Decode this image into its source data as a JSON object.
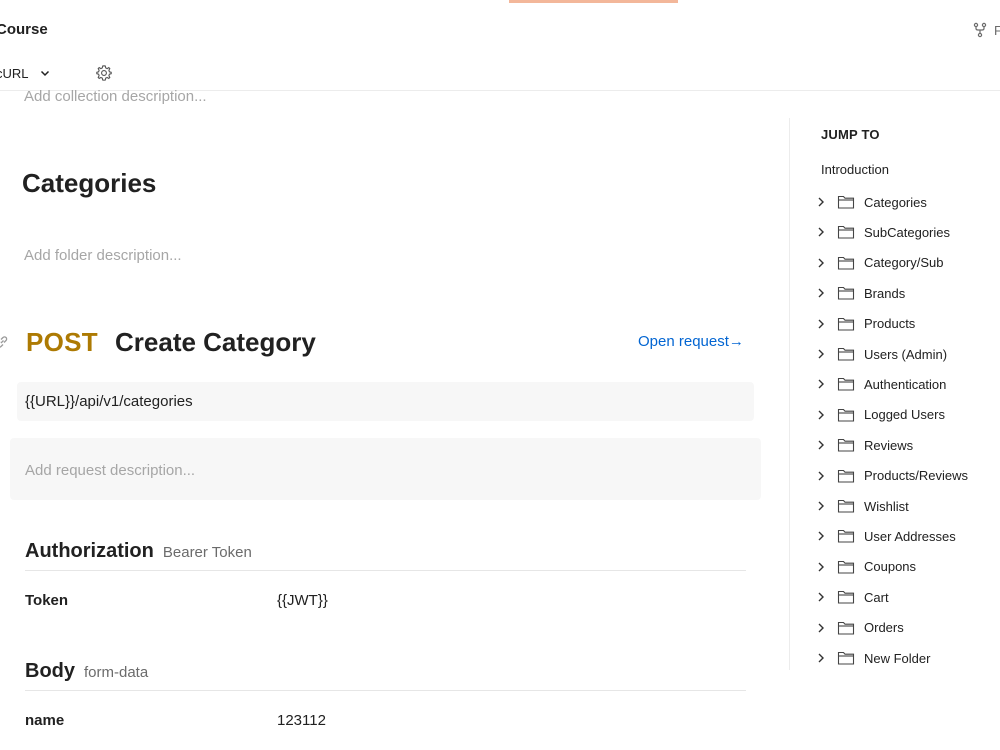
{
  "header": {
    "title": "Course",
    "fork_label": "F",
    "language": "cURL"
  },
  "collection": {
    "description_placeholder": "Add collection description..."
  },
  "folder": {
    "title": "Categories",
    "description_placeholder": "Add folder description..."
  },
  "request": {
    "method": "POST",
    "name": "Create Category",
    "open_request_label": "Open request→",
    "url": "{{URL}}/api/v1/categories",
    "description_placeholder": "Add request description...",
    "method_color": "#ad7a03"
  },
  "authorization": {
    "title": "Authorization",
    "type": "Bearer Token",
    "key": "Token",
    "value": "{{JWT}}"
  },
  "body": {
    "title": "Body",
    "type": "form-data",
    "key": "name",
    "value": "123112"
  },
  "jump_to": {
    "heading": "JUMP TO",
    "intro": "Introduction",
    "items": [
      {
        "label": "Categories"
      },
      {
        "label": "SubCategories"
      },
      {
        "label": "Category/Sub"
      },
      {
        "label": "Brands"
      },
      {
        "label": "Products"
      },
      {
        "label": "Users (Admin)"
      },
      {
        "label": "Authentication"
      },
      {
        "label": "Logged Users"
      },
      {
        "label": "Reviews"
      },
      {
        "label": "Products/Reviews"
      },
      {
        "label": "Wishlist"
      },
      {
        "label": "User Addresses"
      },
      {
        "label": "Coupons"
      },
      {
        "label": "Cart"
      },
      {
        "label": "Orders"
      },
      {
        "label": "New Folder"
      }
    ]
  },
  "icons": {
    "fork": "fork-icon",
    "chevron_down": "chevron-down-icon",
    "gear": "gear-icon",
    "link": "link-icon",
    "chevron_right": "chevron-right-icon",
    "folder": "folder-icon"
  }
}
